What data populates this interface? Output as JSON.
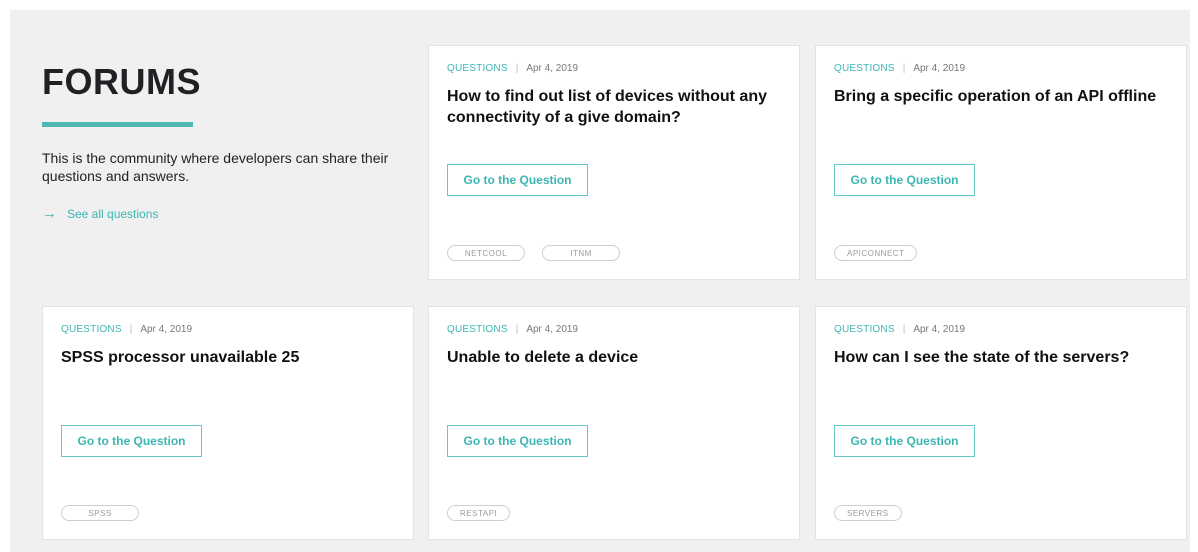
{
  "intro": {
    "title": "FORUMS",
    "description": "This is the community where developers can share their questions and answers.",
    "see_all_label": "See all questions"
  },
  "cards": [
    {
      "category": "QUESTIONS",
      "separator": "|",
      "date": "Apr 4, 2019",
      "title": "How to find out list of devices without any connectivity of a give domain?",
      "button_label": "Go to the Question",
      "tags": [
        "NETCOOL",
        "ITNM"
      ]
    },
    {
      "category": "QUESTIONS",
      "separator": "|",
      "date": "Apr 4, 2019",
      "title": "Bring a specific operation of an API offline",
      "button_label": "Go to the Question",
      "tags": [
        "APICONNECT"
      ]
    },
    {
      "category": "QUESTIONS",
      "separator": "|",
      "date": "Apr 4, 2019",
      "title": "SPSS processor unavailable 25",
      "button_label": "Go to the Question",
      "tags": [
        "SPSS"
      ]
    },
    {
      "category": "QUESTIONS",
      "separator": "|",
      "date": "Apr 4, 2019",
      "title": "Unable to delete a device",
      "button_label": "Go to the Question",
      "tags": [
        "RESTAPI"
      ]
    },
    {
      "category": "QUESTIONS",
      "separator": "|",
      "date": "Apr 4, 2019",
      "title": "How can I see the state of the servers?",
      "button_label": "Go to the Question",
      "tags": [
        "SERVERS"
      ]
    }
  ],
  "colors": {
    "accent": "#3cb6b3",
    "background": "#f0f0f0",
    "card": "#ffffff"
  }
}
